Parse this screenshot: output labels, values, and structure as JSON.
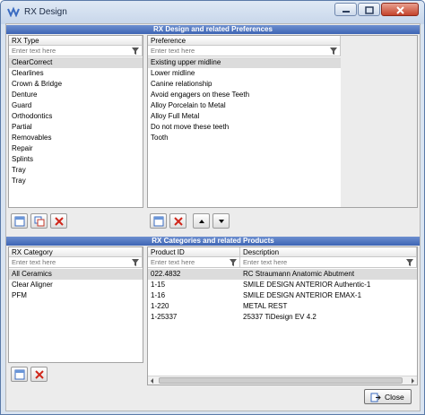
{
  "window": {
    "title": "RX Design"
  },
  "top_section": {
    "header": "RX Design and related Preferences",
    "rx_type": {
      "column": "RX Type",
      "filter_placeholder": "Enter text here",
      "rows": [
        "ClearCorrect",
        "Clearlines",
        "Crown & Bridge",
        "Denture",
        "Guard",
        "Orthodontics",
        "Partial",
        "Removables",
        "Repair",
        "Splints",
        "Tray",
        "Tray"
      ]
    },
    "preference": {
      "column": "Preference",
      "filter_placeholder": "Enter text here",
      "rows": [
        "Existing upper midline",
        "Lower midline",
        "Canine relationship",
        "Avoid engagers on these Teeth",
        "Alloy Porcelain to Metal",
        "Alloy Full Metal",
        "Do not move these teeth",
        "Tooth"
      ]
    }
  },
  "bottom_section": {
    "header": "RX Categories and related Products",
    "rx_category": {
      "column": "RX Category",
      "filter_placeholder": "Enter text here",
      "rows": [
        "All Ceramics",
        "Clear Aligner",
        "PFM"
      ]
    },
    "products": {
      "columns": [
        "Product ID",
        "Description"
      ],
      "filter_placeholder": "Enter text here",
      "rows": [
        {
          "id": "022.4832",
          "desc": "RC Straumann Anatomic Abutment"
        },
        {
          "id": "1-15",
          "desc": "SMILE DESIGN ANTERIOR Authentic-1"
        },
        {
          "id": "1-16",
          "desc": "SMILE DESIGN ANTERIOR EMAX-1"
        },
        {
          "id": "1-220",
          "desc": "METAL REST"
        },
        {
          "id": "1-25337",
          "desc": "25337 TiDesign EV 4.2"
        }
      ]
    }
  },
  "footer": {
    "close_label": "Close"
  },
  "icons": {
    "add": "add-icon",
    "copy": "copy-icon",
    "delete": "delete-icon",
    "up": "arrow-up-icon",
    "down": "arrow-down-icon",
    "filter": "filter-icon"
  }
}
